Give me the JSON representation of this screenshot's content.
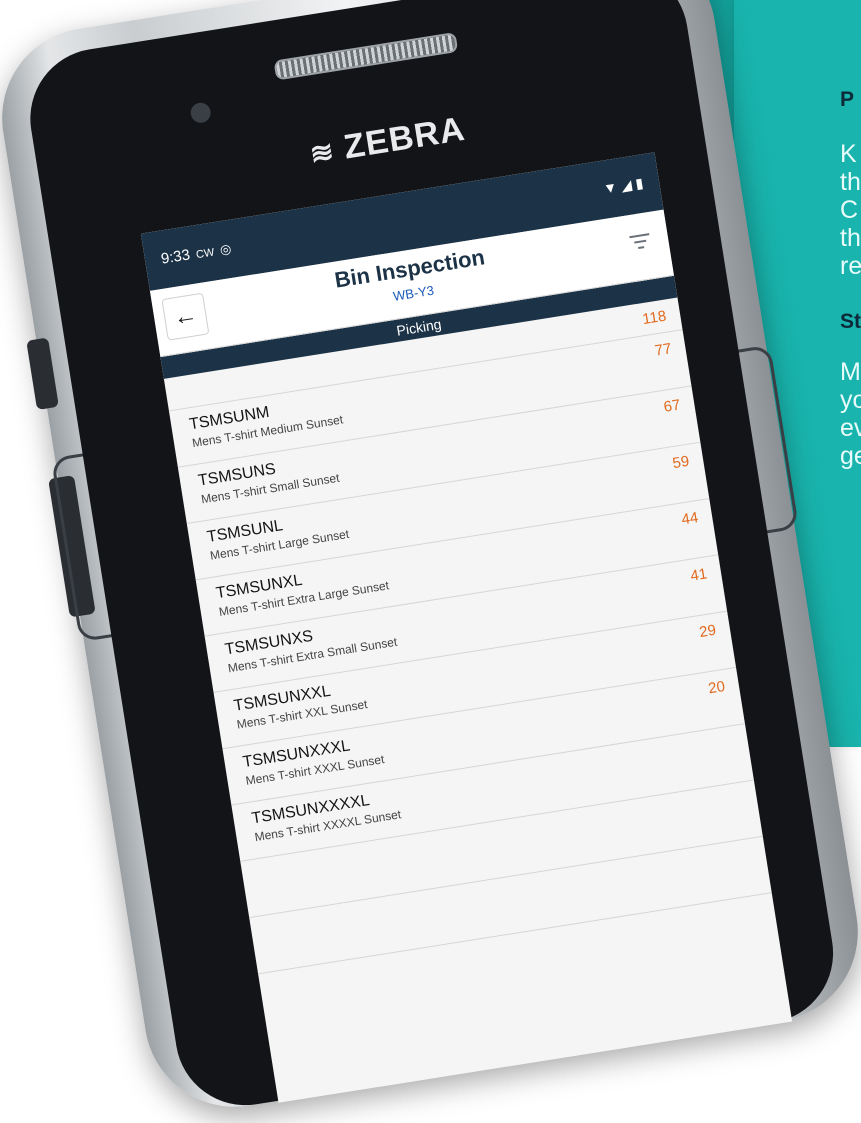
{
  "background": {
    "heading_1": "P",
    "body_1": [
      "K",
      "th",
      "C",
      "th",
      "re"
    ],
    "heading_2": "St",
    "body_2": [
      "M",
      "yo",
      "ev",
      "ge"
    ],
    "accent_color": "#17aea8"
  },
  "device": {
    "brand": "ZEBRA"
  },
  "status_bar": {
    "time": "9:33",
    "carrier": "CW"
  },
  "app_bar": {
    "back_icon": "arrow-left-icon",
    "title": "Bin Inspection",
    "subtitle": "WB-Y3",
    "filter_icon": "filter-icon"
  },
  "section": {
    "label": "Picking"
  },
  "list": {
    "top_count": "118",
    "items": [
      {
        "sku": "TSMSUNM",
        "description": "Mens T-shirt Medium Sunset",
        "count": "77"
      },
      {
        "sku": "TSMSUNS",
        "description": "Mens T-shirt Small Sunset",
        "count": "67"
      },
      {
        "sku": "TSMSUNL",
        "description": "Mens T-shirt Large Sunset",
        "count": "59"
      },
      {
        "sku": "TSMSUNXL",
        "description": "Mens T-shirt Extra Large Sunset",
        "count": "44"
      },
      {
        "sku": "TSMSUNXS",
        "description": "Mens T-shirt Extra Small Sunset",
        "count": "41"
      },
      {
        "sku": "TSMSUNXXL",
        "description": "Mens T-shirt XXL Sunset",
        "count": "29"
      },
      {
        "sku": "TSMSUNXXXL",
        "description": "Mens T-shirt XXXL Sunset",
        "count": "20"
      },
      {
        "sku": "TSMSUNXXXXL",
        "description": "Mens T-shirt XXXXL Sunset",
        "count": ""
      }
    ]
  },
  "colors": {
    "header_navy": "#1c3347",
    "count_orange": "#e06a1e",
    "subtitle_blue": "#1b5ab8"
  }
}
